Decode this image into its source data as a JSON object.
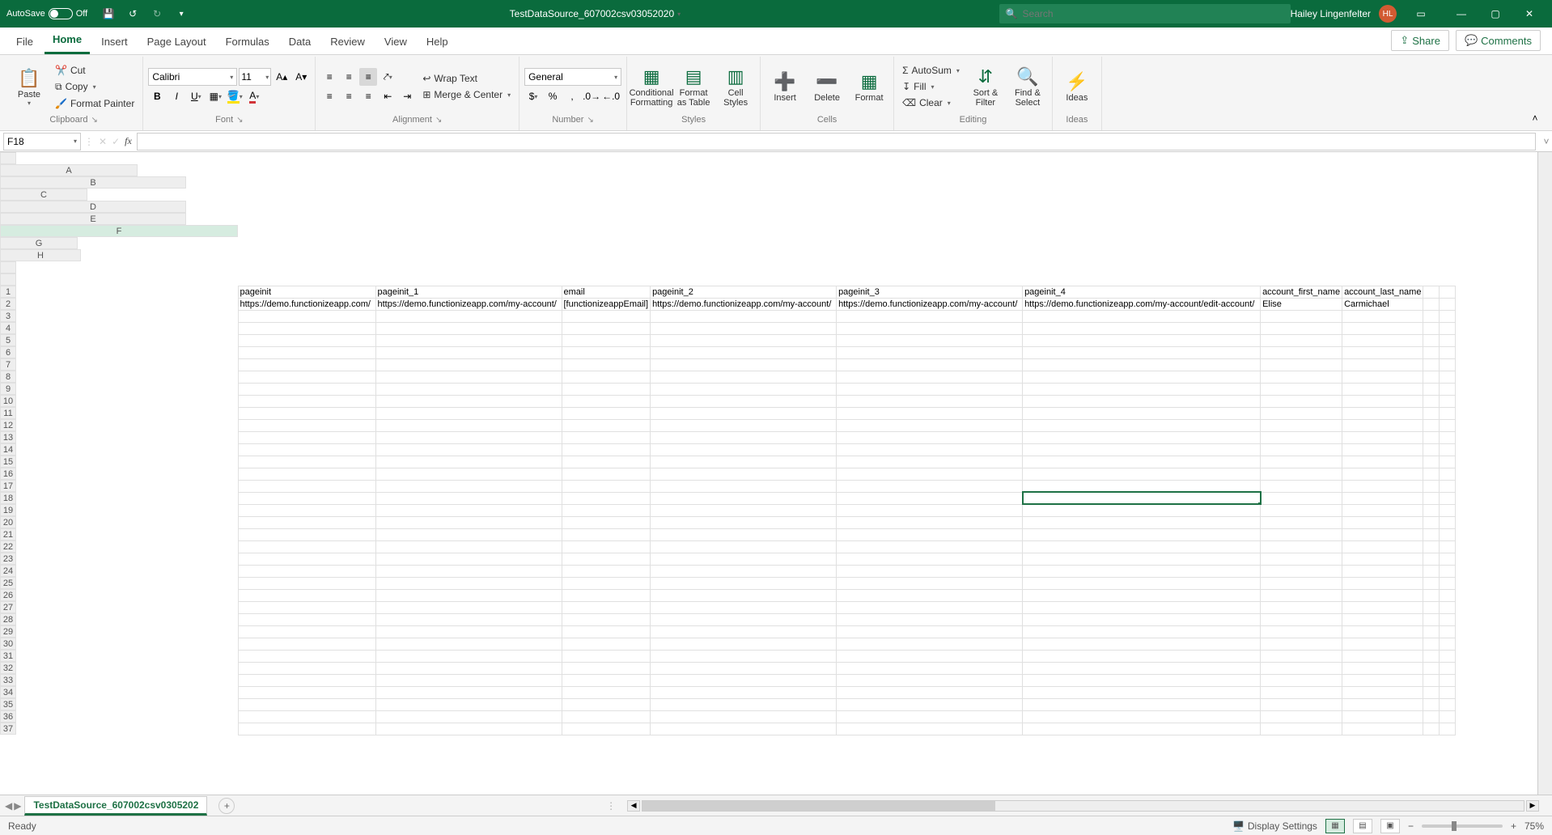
{
  "titlebar": {
    "autosave_label": "AutoSave",
    "autosave_state": "Off",
    "doc_title": "TestDataSource_607002csv03052020",
    "search_placeholder": "Search",
    "user_name": "Hailey Lingenfelter",
    "user_initials": "HL"
  },
  "tabs": {
    "file": "File",
    "home": "Home",
    "insert": "Insert",
    "page_layout": "Page Layout",
    "formulas": "Formulas",
    "data": "Data",
    "review": "Review",
    "view": "View",
    "help": "Help",
    "share": "Share",
    "comments": "Comments"
  },
  "ribbon": {
    "clipboard": {
      "paste": "Paste",
      "cut": "Cut",
      "copy": "Copy",
      "format_painter": "Format Painter",
      "label": "Clipboard"
    },
    "font": {
      "name": "Calibri",
      "size": "11",
      "label": "Font"
    },
    "alignment": {
      "wrap": "Wrap Text",
      "merge": "Merge & Center",
      "label": "Alignment"
    },
    "number": {
      "format": "General",
      "label": "Number"
    },
    "styles": {
      "cond": "Conditional Formatting",
      "fat": "Format as Table",
      "cell": "Cell Styles",
      "label": "Styles"
    },
    "cells": {
      "insert": "Insert",
      "delete": "Delete",
      "format": "Format",
      "label": "Cells"
    },
    "editing": {
      "autosum": "AutoSum",
      "fill": "Fill",
      "clear": "Clear",
      "sort": "Sort & Filter",
      "find": "Find & Select",
      "label": "Editing"
    },
    "ideas": {
      "ideas": "Ideas",
      "label": "Ideas"
    }
  },
  "namebox": "F18",
  "columns": [
    "A",
    "B",
    "C",
    "D",
    "E",
    "F",
    "G",
    "H"
  ],
  "col_widths": [
    "col-A",
    "col-B",
    "col-C",
    "col-D",
    "col-E",
    "col-F",
    "col-G",
    "col-H"
  ],
  "selected_col_index": 5,
  "selected_cell": {
    "row": 18,
    "col": 5
  },
  "num_rows": 37,
  "sheet_data": {
    "headers": [
      "pageinit",
      "pageinit_1",
      "email",
      "pageinit_2",
      "pageinit_3",
      "pageinit_4",
      "account_first_name",
      "account_last_name"
    ],
    "row2": [
      "https://demo.functionizeapp.com/",
      "https://demo.functionizeapp.com/my-account/",
      "[functionizeappEmail]",
      "https://demo.functionizeapp.com/my-account/",
      "https://demo.functionizeapp.com/my-account/",
      "https://demo.functionizeapp.com/my-account/edit-account/",
      "Elise",
      "Carmichael"
    ]
  },
  "sheet_tab": "TestDataSource_607002csv0305202",
  "status": {
    "ready": "Ready",
    "display_settings": "Display Settings",
    "zoom": "75%"
  }
}
